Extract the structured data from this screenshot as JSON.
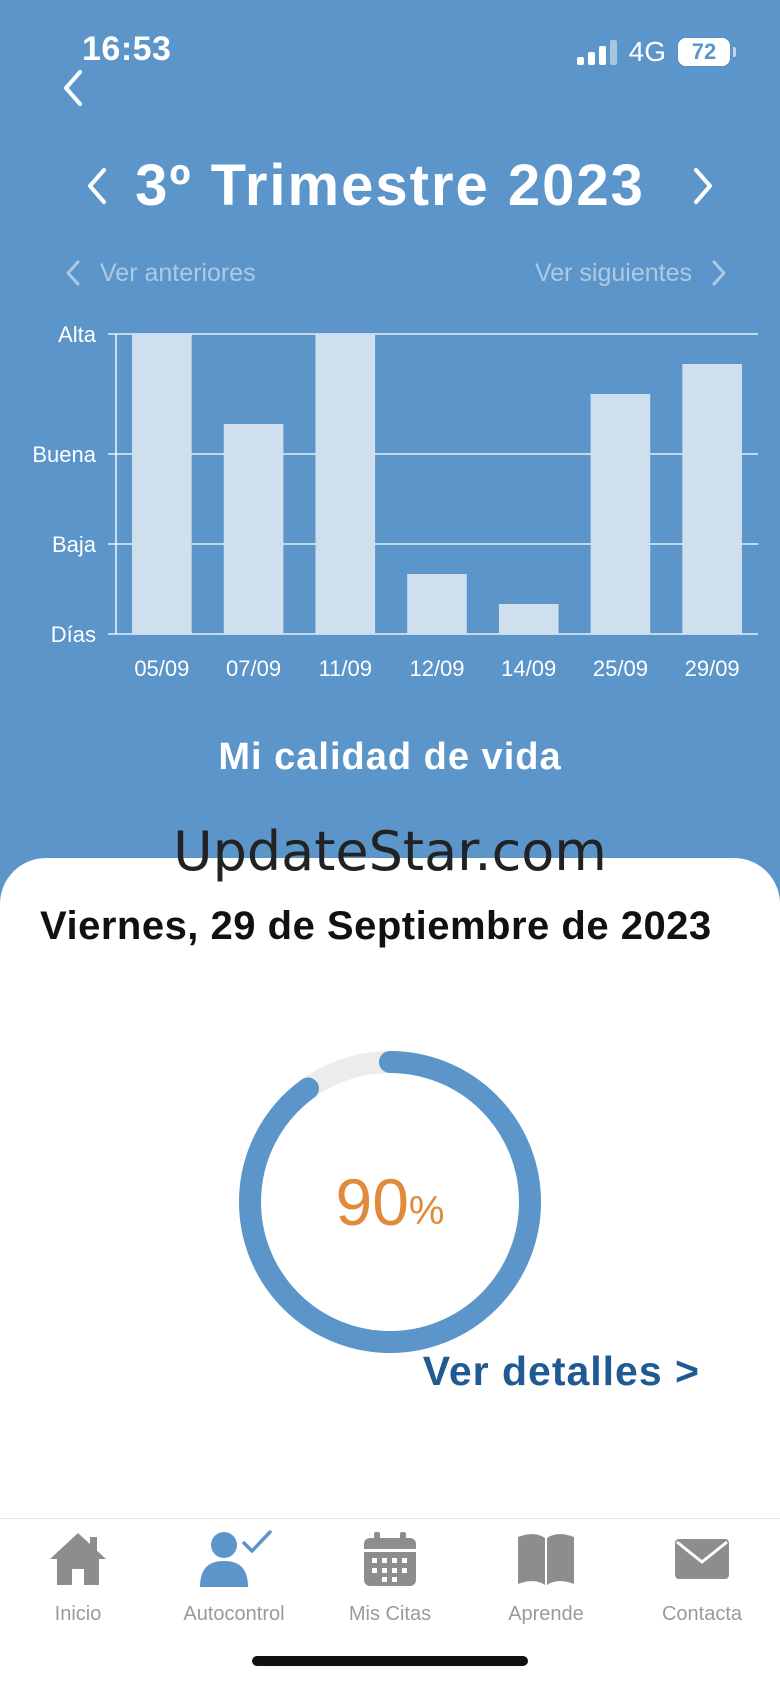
{
  "status_bar": {
    "time": "16:53",
    "network": "4G",
    "battery": "72"
  },
  "header": {
    "title": "3º Trimestre 2023",
    "prev_label": "Ver anteriores",
    "next_label": "Ver siguientes"
  },
  "chart_data": {
    "type": "bar",
    "categories": [
      "05/09",
      "07/09",
      "11/09",
      "12/09",
      "14/09",
      "25/09",
      "29/09"
    ],
    "values": [
      100,
      70,
      100,
      20,
      10,
      80,
      90
    ],
    "y_ticks": [
      {
        "label": "Alta",
        "value": 100
      },
      {
        "label": "Buena",
        "value": 60
      },
      {
        "label": "Baja",
        "value": 30
      },
      {
        "label": "Días",
        "value": 0
      }
    ],
    "ylim": [
      0,
      100
    ],
    "title": "Mi calidad de vida",
    "bar_color": "#d0dfee",
    "grid": true
  },
  "watermark": "UpdateStar.com",
  "detail_card": {
    "date": "Viernes, 29 de Septiembre de 2023",
    "gauge_value": "90",
    "gauge_unit": "%",
    "gauge_fraction": 0.9,
    "details_link": "Ver detalles >"
  },
  "tabs": [
    {
      "label": "Inicio",
      "icon": "home-icon"
    },
    {
      "label": "Autocontrol",
      "icon": "user-check-icon"
    },
    {
      "label": "Mis Citas",
      "icon": "calendar-icon"
    },
    {
      "label": "Aprende",
      "icon": "book-icon"
    },
    {
      "label": "Contacta",
      "icon": "mail-icon"
    }
  ],
  "colors": {
    "background": "#5b95c9",
    "accent": "#5b95c9",
    "gauge_text": "#e08a3c",
    "link": "#1f5a93",
    "tab_inactive": "#8d8d8d"
  }
}
